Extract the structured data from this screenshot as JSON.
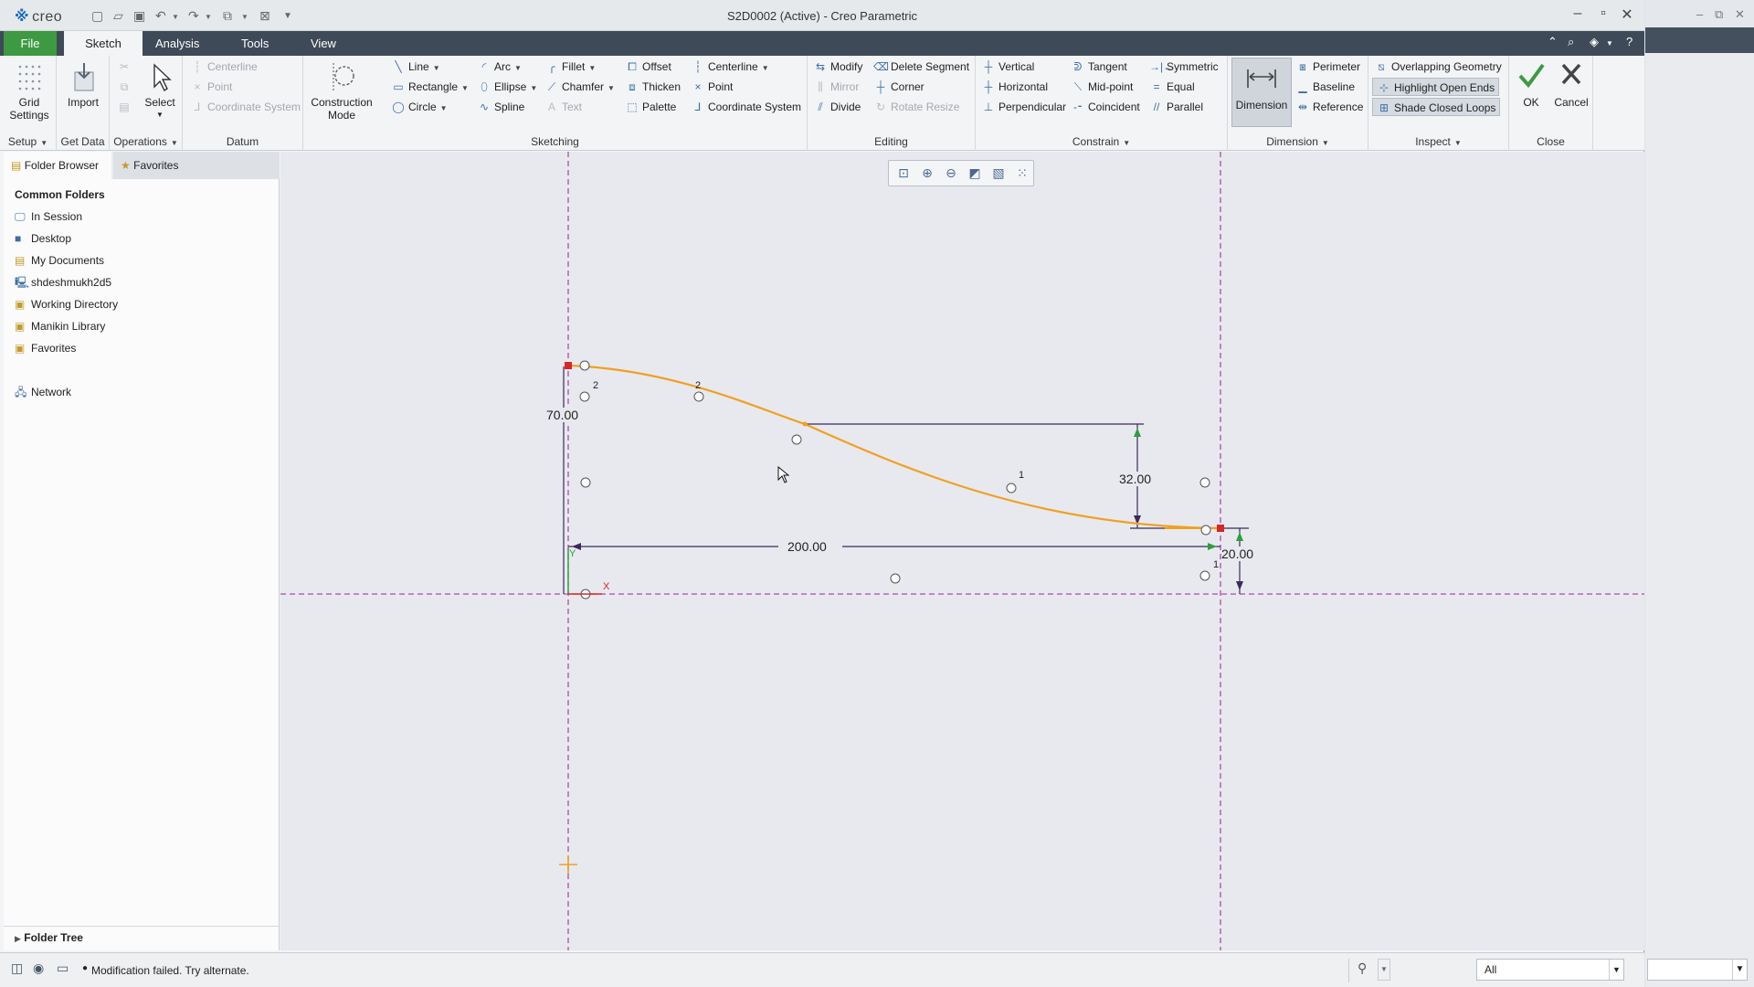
{
  "titlebar": {
    "logo": "creo",
    "title": "S2D0002 (Active) - Creo Parametric"
  },
  "tabs": [
    {
      "label": "File"
    },
    {
      "label": "Sketch"
    },
    {
      "label": "Analysis"
    },
    {
      "label": "Tools"
    },
    {
      "label": "View"
    }
  ],
  "ribbon": {
    "setup": {
      "label": "Setup",
      "grid_settings": "Grid Settings"
    },
    "getdata": {
      "label": "Get Data",
      "import": "Import"
    },
    "operations": {
      "label": "Operations",
      "select": "Select"
    },
    "datum": {
      "label": "Datum",
      "centerline": "Centerline",
      "point": "Point",
      "coordsys": "Coordinate System"
    },
    "sketching": {
      "label": "Sketching",
      "construction_mode": "Construction Mode",
      "line": "Line",
      "rectangle": "Rectangle",
      "circle": "Circle",
      "arc": "Arc",
      "ellipse": "Ellipse",
      "spline": "Spline",
      "fillet": "Fillet",
      "chamfer": "Chamfer",
      "text": "Text",
      "offset": "Offset",
      "thicken": "Thicken",
      "palette": "Palette",
      "centerline": "Centerline",
      "point": "Point",
      "coordsys": "Coordinate System"
    },
    "editing": {
      "label": "Editing",
      "modify": "Modify",
      "mirror": "Mirror",
      "divide": "Divide",
      "delete_segment": "Delete Segment",
      "corner": "Corner",
      "rotate_resize": "Rotate Resize"
    },
    "constrain": {
      "label": "Constrain",
      "vertical": "Vertical",
      "horizontal": "Horizontal",
      "perpendicular": "Perpendicular",
      "tangent": "Tangent",
      "midpoint": "Mid-point",
      "coincident": "Coincident",
      "symmetric": "Symmetric",
      "equal": "Equal",
      "parallel": "Parallel"
    },
    "dimension": {
      "label": "Dimension",
      "dimension": "Dimension",
      "perimeter": "Perimeter",
      "baseline": "Baseline",
      "reference": "Reference"
    },
    "inspect": {
      "label": "Inspect",
      "overlapping": "Overlapping Geometry",
      "highlight": "Highlight Open Ends",
      "shade": "Shade Closed Loops"
    },
    "close": {
      "label": "Close",
      "ok": "OK",
      "cancel": "Cancel"
    }
  },
  "leftpanel": {
    "tabs": [
      "Folder Browser",
      "Favorites"
    ],
    "section": "Common Folders",
    "folders": [
      "In Session",
      "Desktop",
      "My Documents",
      "shdeshmukh2d5",
      "Working Directory",
      "Manikin Library",
      "Favorites"
    ],
    "network": "Network",
    "tree": "Folder Tree"
  },
  "sketch": {
    "dims": {
      "height_left": "70.00",
      "drop": "32.00",
      "width": "200.00",
      "height_right": "20.00"
    },
    "constraint_marks": [
      "2",
      "2",
      "1",
      "1"
    ],
    "axis_x": "X",
    "axis_y": "Y",
    "colors": {
      "spline": "#f0a020",
      "centerline": "#b04aa8",
      "dimension": "#3d2a5c",
      "endpoint": "#d62828"
    }
  },
  "status": {
    "message": "Modification failed. Try alternate.",
    "filter": "All"
  }
}
